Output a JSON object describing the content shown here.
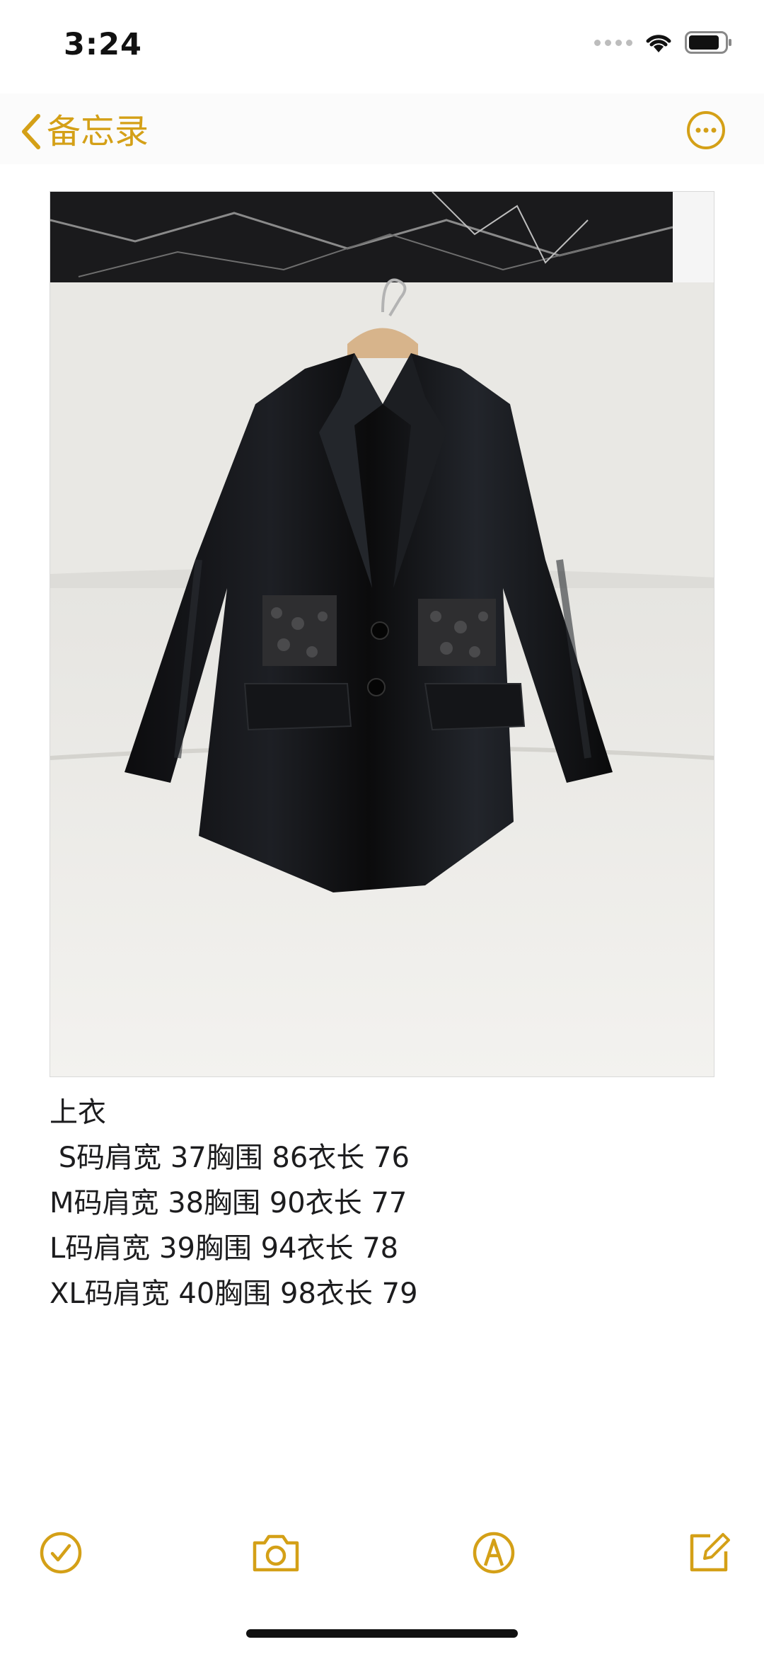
{
  "status_bar": {
    "time": "3:24",
    "icons": [
      "cellular-signal-icon",
      "wifi-icon",
      "battery-icon"
    ]
  },
  "nav": {
    "back_label": "备忘录",
    "back_icon": "chevron-left-icon",
    "more_icon": "ellipsis-circle-icon"
  },
  "colors": {
    "accent": "#d4a017",
    "text": "#1c1c1e"
  },
  "note": {
    "lines": [
      "上衣",
      " S码肩宽 37胸围 86衣长 76",
      "M码肩宽 38胸围 90衣长 77",
      "L码肩宽 39胸围 94衣长 78",
      "XL码肩宽 40胸围 98衣长 79"
    ]
  },
  "toolbar": {
    "icons": [
      "checklist-icon",
      "camera-icon",
      "markup-pen-icon",
      "compose-icon"
    ]
  }
}
